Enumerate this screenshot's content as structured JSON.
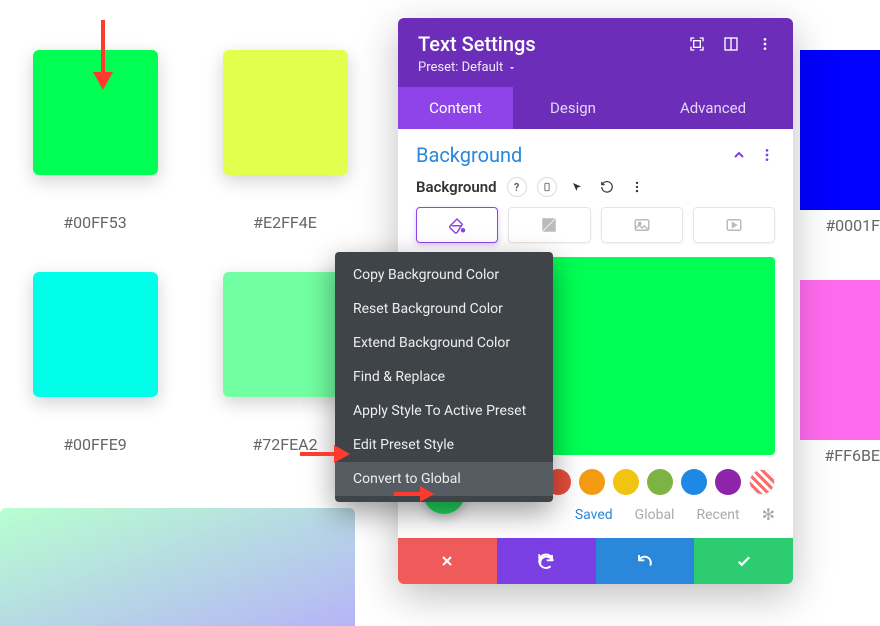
{
  "swatches": [
    {
      "color": "#00FF53",
      "label": "#00FF53"
    },
    {
      "color": "#E2FF4E",
      "label": "#E2FF4E"
    },
    {
      "color": "#00FFE9",
      "label": "#00FFE9"
    },
    {
      "color": "#72FEA2",
      "label": "#72FEA2"
    }
  ],
  "right_blocks": {
    "top": {
      "color": "#0001FE",
      "label": "#0001F"
    },
    "mid": {
      "color": "#FF6BEE",
      "label": "#FF6BE"
    }
  },
  "gradient": {
    "from": "#b7ffd0",
    "to": "#b6b4f7"
  },
  "panel": {
    "title": "Text Settings",
    "preset": "Preset: Default",
    "tabs": [
      "Content",
      "Design",
      "Advanced"
    ],
    "active_tab": 0,
    "section": {
      "title": "Background",
      "row_label": "Background"
    },
    "preview_color": "#00FF53",
    "palette": [
      "#000000",
      "hollow",
      "#e74c3c",
      "#f39c12",
      "#f1c40f",
      "#7cb342",
      "#1e88e5",
      "#8e24aa",
      "stripe"
    ],
    "palette_tabs": {
      "saved": "Saved",
      "global": "Global",
      "recent": "Recent",
      "active": "saved"
    }
  },
  "context_menu": {
    "items": [
      "Copy Background Color",
      "Reset Background Color",
      "Extend Background Color",
      "Find & Replace",
      "Apply Style To Active Preset",
      "Edit Preset Style",
      "Convert to Global"
    ],
    "hover_index": 6
  }
}
